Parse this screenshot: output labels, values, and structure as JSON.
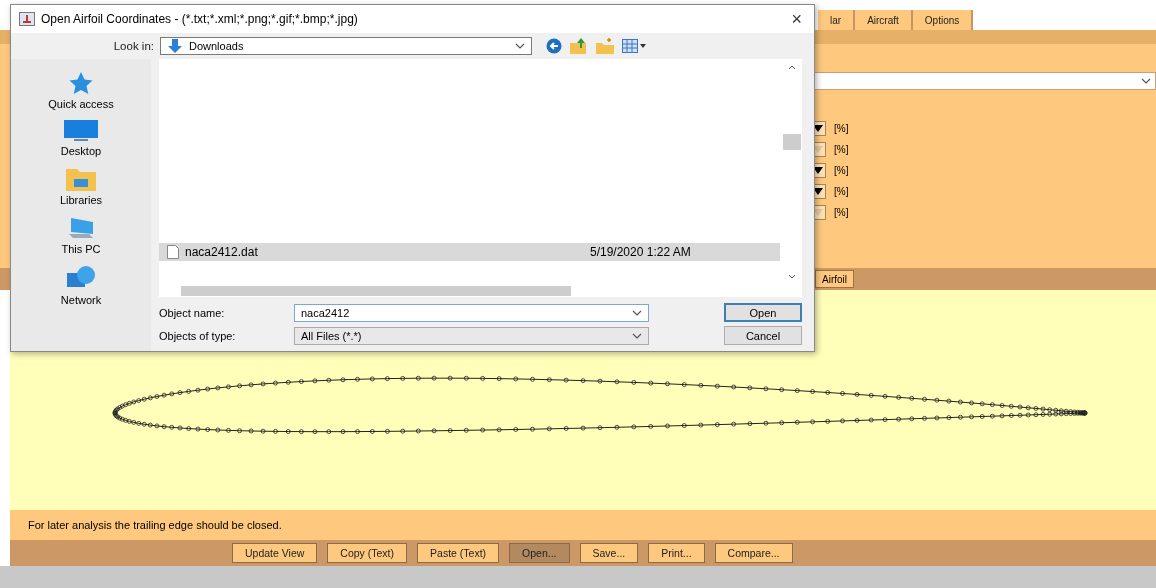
{
  "app": {
    "tabs": [
      {
        "label": "lar",
        "selected": false
      },
      {
        "label": "Aircraft",
        "selected": false
      },
      {
        "label": "Options",
        "selected": false
      }
    ],
    "unit_rows": [
      {
        "unit": "[%]",
        "disabled": false
      },
      {
        "unit": "[%]",
        "disabled": true
      },
      {
        "unit": "[%]",
        "disabled": false
      },
      {
        "unit": "[%]",
        "disabled": false
      },
      {
        "unit": "[%]",
        "disabled": true
      }
    ],
    "airfoil_button": "Airfoil",
    "status": "For later analysis the trailing edge should be closed.",
    "buttons": [
      {
        "label": "Update View",
        "selected": false
      },
      {
        "label": "Copy (Text)",
        "selected": false
      },
      {
        "label": "Paste (Text)",
        "selected": false
      },
      {
        "label": "Open...",
        "selected": true
      },
      {
        "label": "Save...",
        "selected": false
      },
      {
        "label": "Print...",
        "selected": false
      },
      {
        "label": "Compare...",
        "selected": false
      }
    ]
  },
  "dialog": {
    "title": "Open Airfoil Coordinates - (*.txt;*.xml;*.png;*.gif;*.bmp;*.jpg)",
    "close": "×",
    "look_in_label": "Look in:",
    "look_in_value": "Downloads",
    "places": [
      {
        "label": "Quick access",
        "kind": "star"
      },
      {
        "label": "Desktop",
        "kind": "desktop"
      },
      {
        "label": "Libraries",
        "kind": "libraries"
      },
      {
        "label": "This PC",
        "kind": "pc"
      },
      {
        "label": "Network",
        "kind": "network"
      }
    ],
    "files": [
      {
        "name": "naca2412.dat",
        "date": "5/19/2020 1:22 AM",
        "selected": true
      }
    ],
    "name_label": "Object name:",
    "name_value": "naca2412",
    "type_label": "Objects of type:",
    "type_value": "All Files (*.*)",
    "open_button": "Open",
    "cancel_button": "Cancel"
  }
}
